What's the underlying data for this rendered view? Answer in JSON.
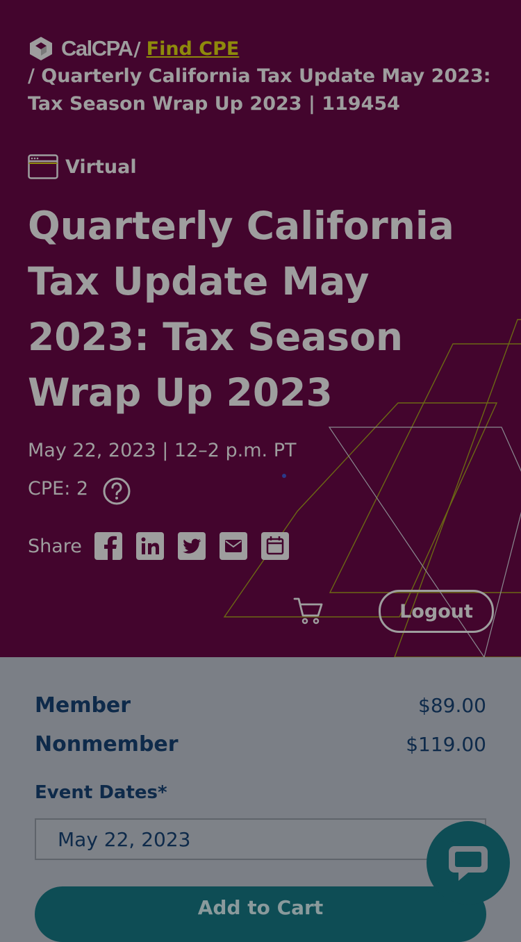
{
  "breadcrumb": {
    "brand": "CalCPA",
    "separator": "/",
    "find_cpe_link": "Find CPE",
    "current": "/ Quarterly California Tax Update May 2023: Tax Season Wrap Up 2023 | 119454"
  },
  "event": {
    "format_label": "Virtual",
    "format_icon": "browser-window-icon",
    "title": "Quarterly California Tax Update May 2023: Tax Season Wrap Up 2023",
    "date_time": "May 22, 2023 | 12–2 p.m. PT",
    "cpe": "CPE: 2"
  },
  "share": {
    "label": "Share",
    "buttons": [
      "facebook-icon",
      "linkedin-icon",
      "twitter-icon",
      "email-icon",
      "calendar-icon"
    ]
  },
  "header_actions": {
    "cart_icon": "cart-icon",
    "logout_label": "Logout"
  },
  "pricing": {
    "member_label": "Member",
    "member_price": "$89.00",
    "nonmember_label": "Nonmember",
    "nonmember_price": "$119.00"
  },
  "registration": {
    "event_dates_label": "Event Dates*",
    "selected_date": "May 22, 2023",
    "add_to_cart_label": "Add to Cart"
  },
  "colors": {
    "hero_background": "#43052d",
    "overlay_gray": "#7b7f86",
    "brand_dark_teal": "#0e4d55",
    "navy_text": "#0e2a4a",
    "link_olive": "#8e8a0c"
  }
}
